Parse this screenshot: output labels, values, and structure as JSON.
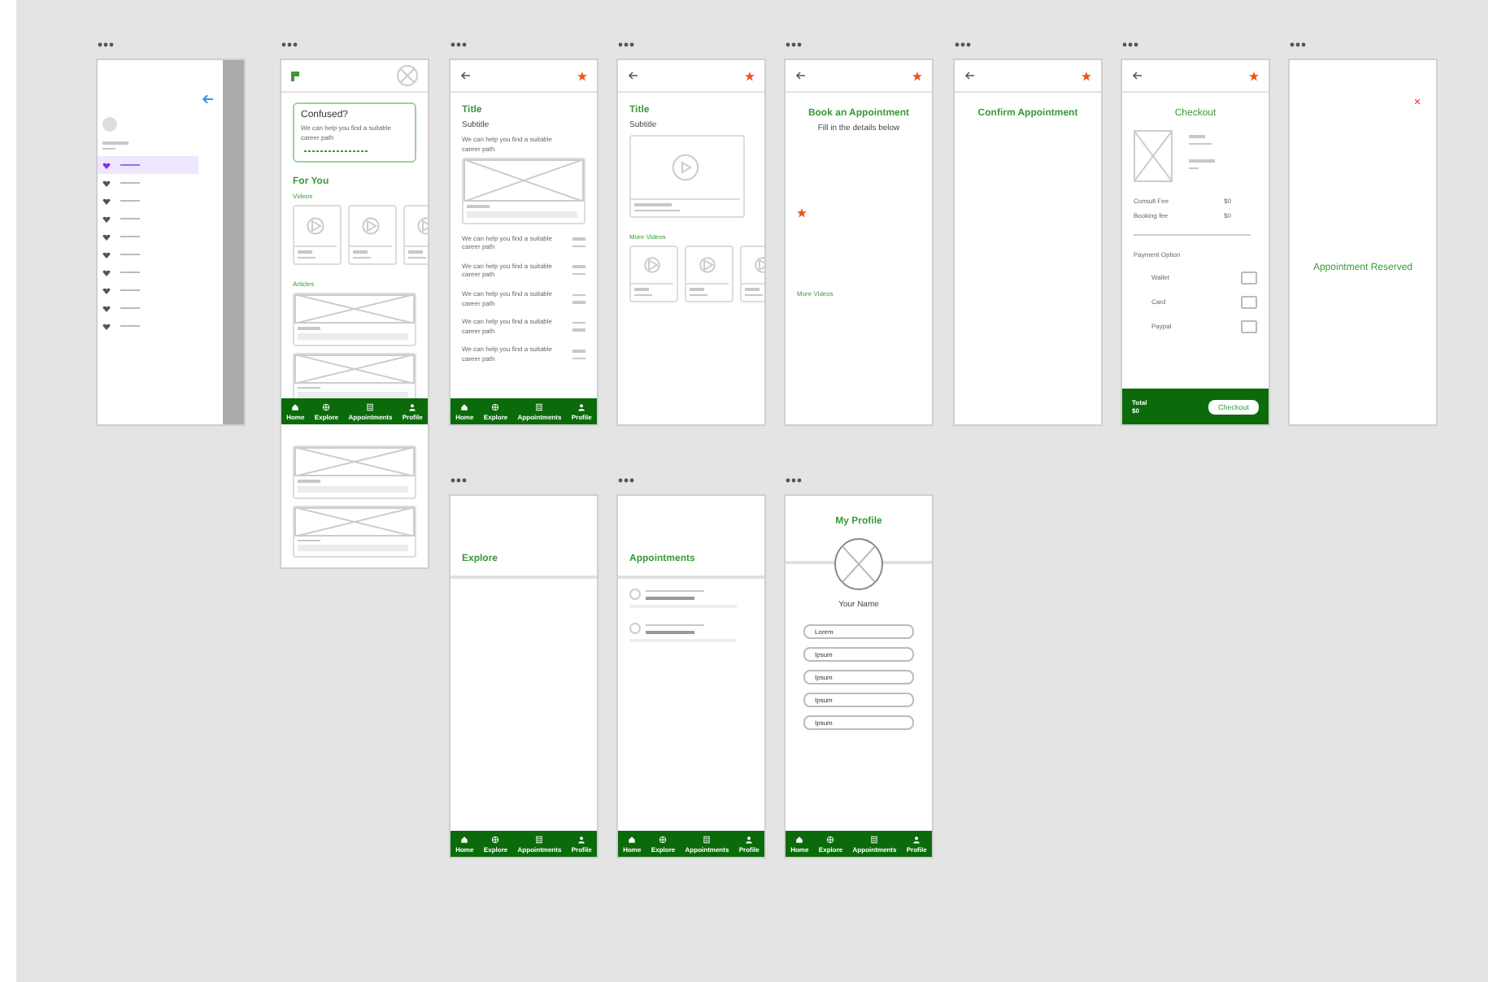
{
  "screens": [
    {
      "kind": "drawer",
      "items": [
        {
          "selected": true
        },
        {
          "selected": false
        },
        {
          "selected": false
        },
        {
          "selected": false
        },
        {
          "selected": false
        },
        {
          "selected": false
        },
        {
          "selected": false
        },
        {
          "selected": false
        },
        {
          "selected": false
        },
        {
          "selected": false
        }
      ]
    },
    {
      "kind": "home",
      "card": {
        "title": "Confused?",
        "body": "We can help you find a suitable career path"
      },
      "section": "For You",
      "videos_label": "Videos",
      "articles_label": "Articles",
      "nav": [
        "Home",
        "Explore",
        "Appointments",
        "Profile"
      ]
    },
    {
      "kind": "detail",
      "title": "Title",
      "subtitle": "Subtitle",
      "body": "We can help you find a suitable career path",
      "rows": [
        "We can help you find a suitable career path",
        "We can help you find a suitable career path",
        "We can help you find a suitable career path",
        "We can help you find a suitable career path",
        "We can help you find a suitable career path"
      ],
      "nav": [
        "Home",
        "Explore",
        "Appointments",
        "Profile"
      ]
    },
    {
      "kind": "video",
      "title": "Title",
      "subtitle": "Subtitle",
      "more_label": "More Videos"
    },
    {
      "kind": "book",
      "title": "Book an Appointment",
      "subtitle": "Fill in the details below",
      "more_label": "More Videos"
    },
    {
      "kind": "confirm",
      "title": "Confirm Appointment"
    },
    {
      "kind": "checkout",
      "title": "Checkout",
      "fees": [
        {
          "label": "Consult Fee",
          "amount": "$0"
        },
        {
          "label": "Booking fee",
          "amount": "$0"
        }
      ],
      "payment_label": "Payment Option",
      "options": [
        {
          "label": "Wallet",
          "checked": false
        },
        {
          "label": "Card",
          "checked": false
        },
        {
          "label": "Paypal",
          "checked": false
        }
      ],
      "total_label": "Total",
      "total": "$0",
      "button": "Checkout"
    },
    {
      "kind": "reserved",
      "title": "Appointment Reserved"
    },
    {
      "kind": "explore",
      "title": "Explore",
      "nav": [
        "Home",
        "Explore",
        "Appointments",
        "Profile"
      ]
    },
    {
      "kind": "appointments",
      "title": "Appointments",
      "nav": [
        "Home",
        "Explore",
        "Appointments",
        "Profile"
      ]
    },
    {
      "kind": "profile",
      "title": "My Profile",
      "name": "Your Name",
      "fields": [
        "Lorem",
        "Ipsum",
        "Ipsum",
        "Ipsum",
        "Ipsum"
      ],
      "nav": [
        "Home",
        "Explore",
        "Appointments",
        "Profile"
      ]
    }
  ]
}
